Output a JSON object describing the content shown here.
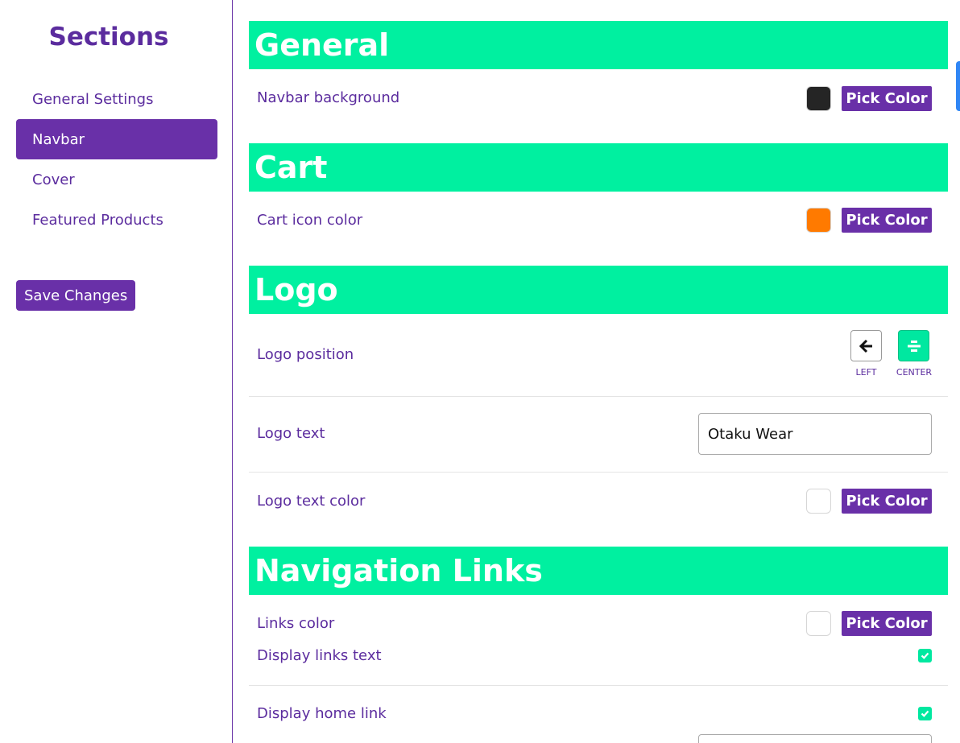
{
  "sidebar": {
    "title": "Sections",
    "items": [
      {
        "label": "General Settings"
      },
      {
        "label": "Navbar"
      },
      {
        "label": "Cover"
      },
      {
        "label": "Featured Products"
      }
    ],
    "save_label": "Save Changes"
  },
  "general": {
    "heading": "General",
    "navbar_bg_label": "Navbar background",
    "navbar_bg_color": "#252525",
    "pick_label": "Pick Color"
  },
  "cart": {
    "heading": "Cart",
    "icon_color_label": "Cart icon color",
    "icon_color": "#ff7a00",
    "pick_label": "Pick Color"
  },
  "logo": {
    "heading": "Logo",
    "position_label": "Logo position",
    "position_left": "LEFT",
    "position_center": "CENTER",
    "selected_position": "CENTER",
    "text_label": "Logo text",
    "text_value": "Otaku Wear",
    "text_color_label": "Logo text color",
    "text_color": "#ffffff",
    "pick_label": "Pick Color"
  },
  "nav_links": {
    "heading": "Navigation Links",
    "links_color_label": "Links color",
    "links_color": "#ffffff",
    "pick_label": "Pick Color",
    "display_text_label": "Display links text",
    "display_text_checked": true,
    "display_home_label": "Display home link",
    "display_home_checked": true
  },
  "colors": {
    "accent": "#6930a8",
    "header_green": "#00f0a0"
  }
}
